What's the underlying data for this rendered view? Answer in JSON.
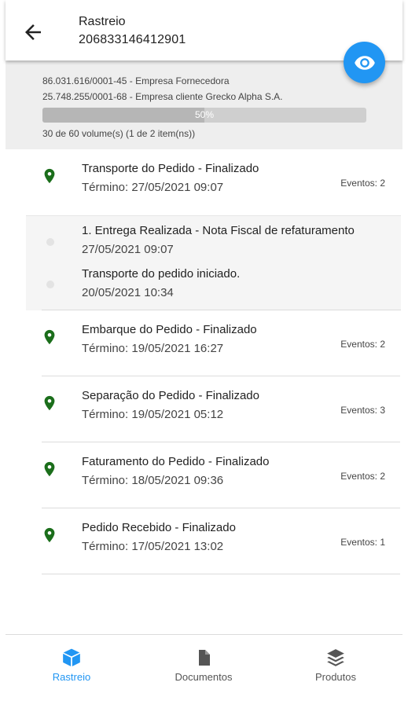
{
  "header": {
    "title": "Rastreio",
    "tracking_code": "206833146412901"
  },
  "summary": {
    "supplier": "86.031.616/0001-45 - Empresa Fornecedora",
    "client": "25.748.255/0001-68 - Empresa cliente Grecko Alpha S.A.",
    "progress_label": "50%",
    "progress_fraction": 0.5,
    "volumes": "30 de 60 volume(s) (1 de 2 item(ns))"
  },
  "events": [
    {
      "title": "Transporte do Pedido - Finalizado",
      "date": "Término: 27/05/2021 09:07",
      "count": "Eventos: 2"
    },
    {
      "title": "Embarque do Pedido - Finalizado",
      "date": "Término: 19/05/2021 16:27",
      "count": "Eventos: 2"
    },
    {
      "title": "Separação do Pedido - Finalizado",
      "date": "Término: 19/05/2021 05:12",
      "count": "Eventos: 3"
    },
    {
      "title": "Faturamento do Pedido - Finalizado",
      "date": "Término: 18/05/2021 09:36",
      "count": "Eventos: 2"
    },
    {
      "title": "Pedido Recebido - Finalizado",
      "date": "Término: 17/05/2021 13:02",
      "count": "Eventos: 1"
    }
  ],
  "sub_events": [
    {
      "title": "1. Entrega Realizada - Nota Fiscal de refaturamento",
      "date": "27/05/2021 09:07"
    },
    {
      "title": "Transporte do pedido iniciado.",
      "date": "20/05/2021 10:34"
    }
  ],
  "nav": {
    "rastreio": "Rastreio",
    "documentos": "Documentos",
    "produtos": "Produtos"
  },
  "colors": {
    "accent": "#2196f3",
    "pin": "#1b6e1b",
    "summary_bg": "#eeeeee"
  }
}
